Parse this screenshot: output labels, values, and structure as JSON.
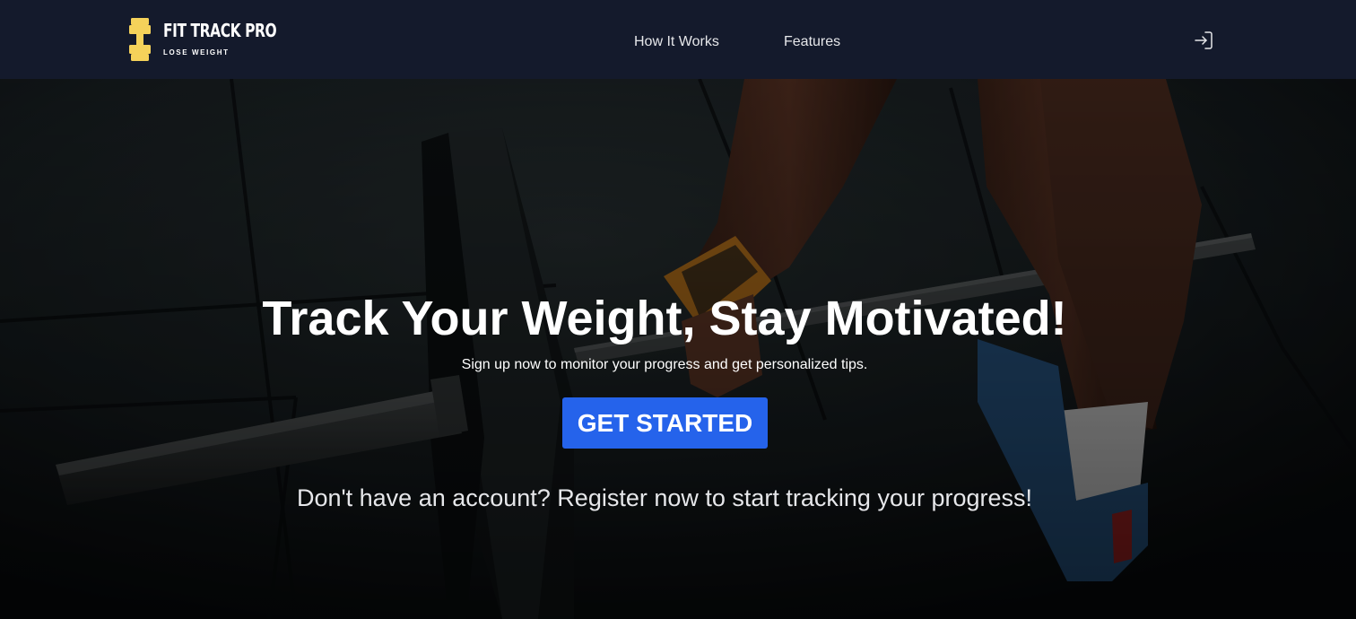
{
  "header": {
    "brand": {
      "title": "FIT TRACK PRO",
      "tagline": "LOSE WEIGHT",
      "icon": "dumbbell-icon",
      "icon_color": "#f5d25a"
    },
    "nav": [
      {
        "label": "How It Works"
      },
      {
        "label": "Features"
      }
    ],
    "login_icon": "login-icon",
    "background": "#141a2c"
  },
  "hero": {
    "background_image": "gym-deadlift-photo",
    "title": "Track Your Weight, Stay Motivated!",
    "subtitle": "Sign up now to monitor your progress and get personalized tips.",
    "cta_label": "GET STARTED",
    "cta_color": "#2563eb",
    "register_text": "Don't have an account? Register now to start tracking your progress!"
  }
}
